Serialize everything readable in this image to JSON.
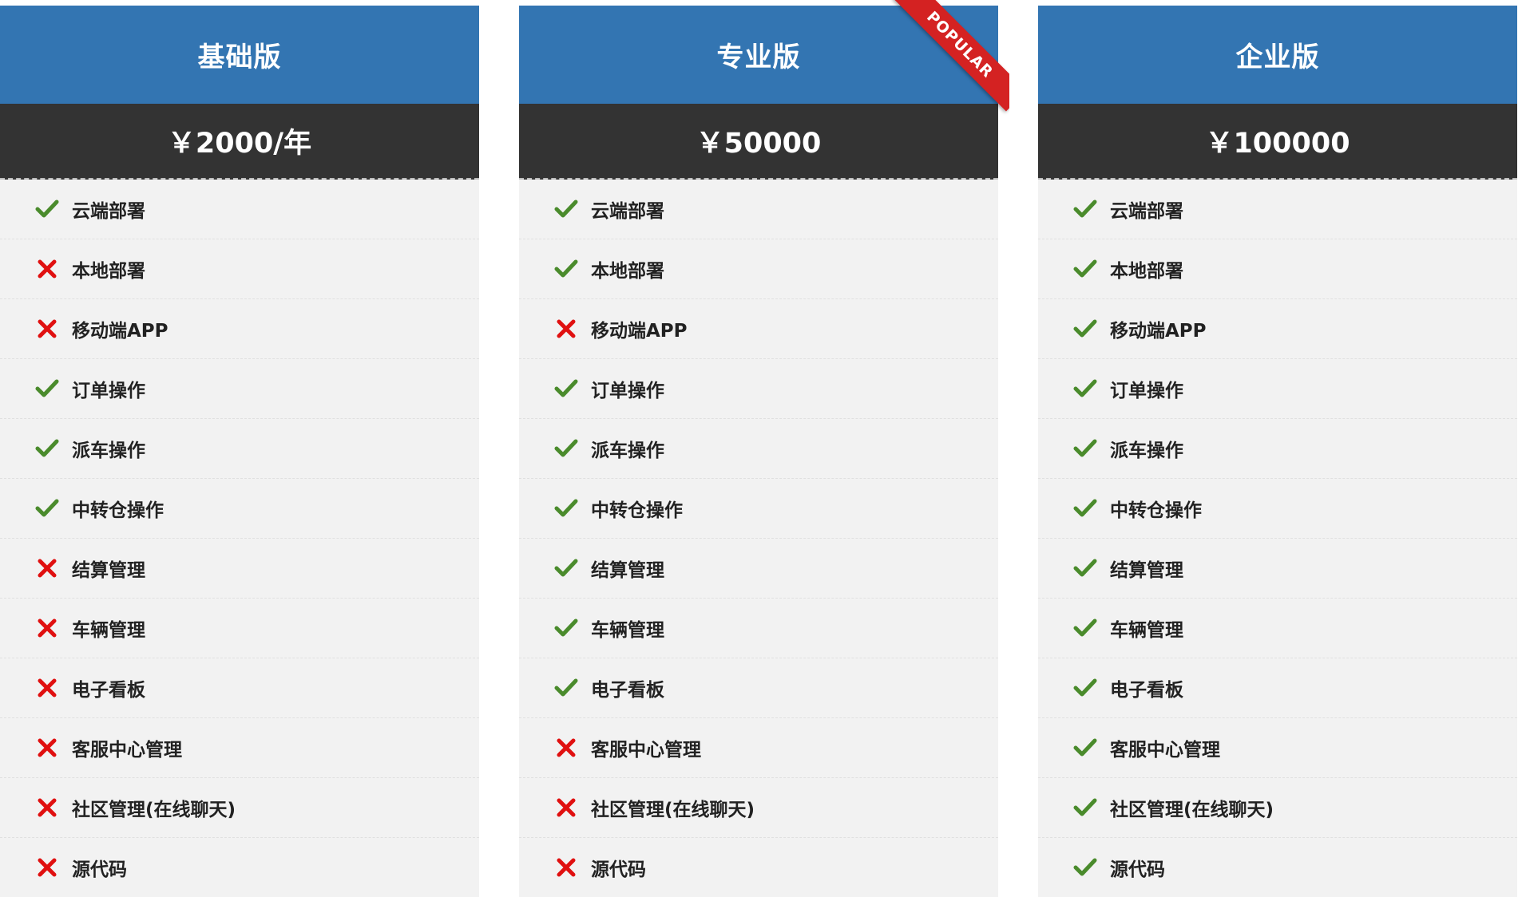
{
  "colors": {
    "header": "#3375b2",
    "price_bar": "#333333",
    "row_bg": "#f2f2f2",
    "check": "#4a8b2c",
    "cross": "#e01010",
    "ribbon": "#d42222"
  },
  "plans": [
    {
      "name": "基础版",
      "price": "￥2000/年",
      "features": [
        {
          "label": "云端部署",
          "included": true
        },
        {
          "label": "本地部署",
          "included": false
        },
        {
          "label": "移动端APP",
          "included": false
        },
        {
          "label": "订单操作",
          "included": true
        },
        {
          "label": "派车操作",
          "included": true
        },
        {
          "label": "中转仓操作",
          "included": true
        },
        {
          "label": "结算管理",
          "included": false
        },
        {
          "label": "车辆管理",
          "included": false
        },
        {
          "label": "电子看板",
          "included": false
        },
        {
          "label": "客服中心管理",
          "included": false
        },
        {
          "label": "社区管理(在线聊天)",
          "included": false
        },
        {
          "label": "源代码",
          "included": false
        }
      ]
    },
    {
      "name": "专业版",
      "price": "￥50000",
      "ribbon": "POPULAR",
      "features": [
        {
          "label": "云端部署",
          "included": true
        },
        {
          "label": "本地部署",
          "included": true
        },
        {
          "label": "移动端APP",
          "included": false
        },
        {
          "label": "订单操作",
          "included": true
        },
        {
          "label": "派车操作",
          "included": true
        },
        {
          "label": "中转仓操作",
          "included": true
        },
        {
          "label": "结算管理",
          "included": true
        },
        {
          "label": "车辆管理",
          "included": true
        },
        {
          "label": "电子看板",
          "included": true
        },
        {
          "label": "客服中心管理",
          "included": false
        },
        {
          "label": "社区管理(在线聊天)",
          "included": false
        },
        {
          "label": "源代码",
          "included": false
        }
      ]
    },
    {
      "name": "企业版",
      "price": "￥100000",
      "features": [
        {
          "label": "云端部署",
          "included": true
        },
        {
          "label": "本地部署",
          "included": true
        },
        {
          "label": "移动端APP",
          "included": true
        },
        {
          "label": "订单操作",
          "included": true
        },
        {
          "label": "派车操作",
          "included": true
        },
        {
          "label": "中转仓操作",
          "included": true
        },
        {
          "label": "结算管理",
          "included": true
        },
        {
          "label": "车辆管理",
          "included": true
        },
        {
          "label": "电子看板",
          "included": true
        },
        {
          "label": "客服中心管理",
          "included": true
        },
        {
          "label": "社区管理(在线聊天)",
          "included": true
        },
        {
          "label": "源代码",
          "included": true
        }
      ]
    }
  ]
}
